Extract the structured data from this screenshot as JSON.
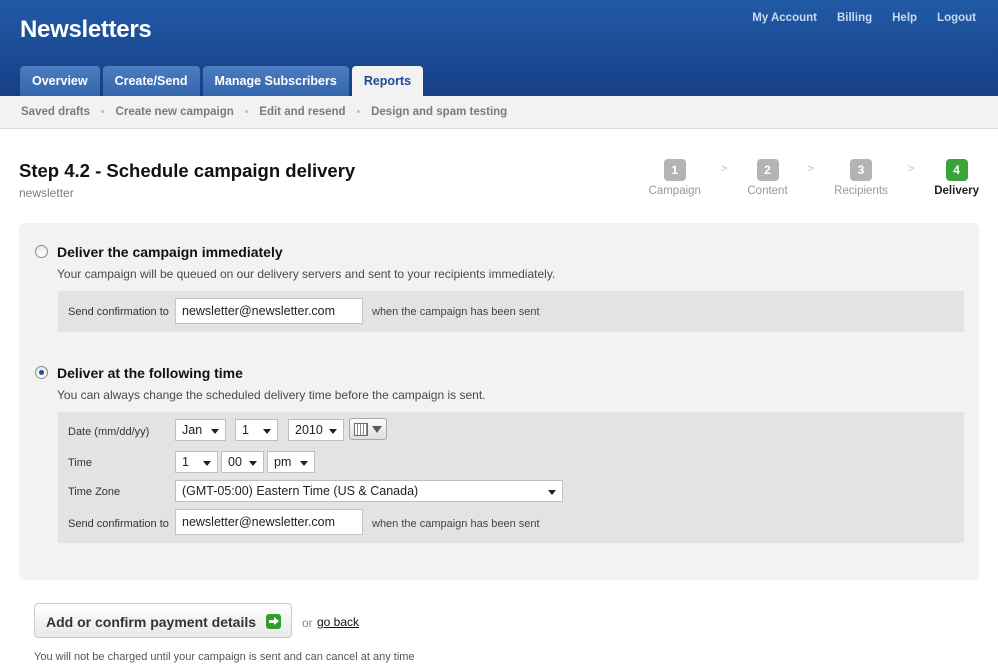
{
  "header": {
    "brand": "Newsletters",
    "account_links": [
      "My Account",
      "Billing",
      "Help",
      "Logout"
    ],
    "tabs": [
      {
        "label": "Overview"
      },
      {
        "label": "Create/Send"
      },
      {
        "label": "Manage Subscribers"
      },
      {
        "label": "Reports"
      }
    ],
    "active_tab": "Reports"
  },
  "subnav": {
    "items": [
      "Saved drafts",
      "Create new campaign",
      "Edit and resend",
      "Design and spam testing"
    ],
    "separator": "•"
  },
  "page": {
    "title": "Step 4.2 - Schedule campaign delivery",
    "subtitle": "newsletter"
  },
  "steps": {
    "arrow": ">",
    "items": [
      {
        "num": "1",
        "label": "Campaign"
      },
      {
        "num": "2",
        "label": "Content"
      },
      {
        "num": "3",
        "label": "Recipients"
      },
      {
        "num": "4",
        "label": "Delivery"
      }
    ],
    "active": "4"
  },
  "options": {
    "immediate": {
      "title": "Deliver the campaign immediately",
      "desc": "Your campaign will be queued on our delivery servers and sent to your recipients immediately.",
      "selected": false,
      "confirm_label": "Send confirmation to",
      "confirm_value": "newsletter@newsletter.com",
      "confirm_after": "when the campaign has been sent"
    },
    "scheduled": {
      "title": "Deliver at the following time",
      "desc": "You can always change the scheduled delivery time before the campaign is sent.",
      "selected": true,
      "date_label": "Date (mm/dd/yy)",
      "month": "Jan",
      "day": "1",
      "year": "2010",
      "time_label": "Time",
      "hour": "1",
      "minute": "00",
      "ampm": "pm",
      "timezone_label": "Time Zone",
      "timezone": "(GMT-05:00) Eastern Time (US & Canada)",
      "confirm_label": "Send confirmation to",
      "confirm_value": "newsletter@newsletter.com",
      "confirm_after": "when the campaign has been sent"
    }
  },
  "actions": {
    "pay_button": "Add or confirm payment details",
    "or_text": "or",
    "back_link": "go back",
    "footnote": "You will not be charged until your campaign is sent and can cancel at any time"
  },
  "colors": {
    "header_blue": "#1e4d9a",
    "tab_blue": "#3f72b9",
    "step_active": "#3aa33a",
    "step_inactive": "#b4b4b4",
    "panel_bg": "#f2f2f2"
  },
  "icons": {
    "calendar": "calendar-icon",
    "dropdown": "chevron-down-icon",
    "pay_arrow": "arrow-right-icon"
  }
}
